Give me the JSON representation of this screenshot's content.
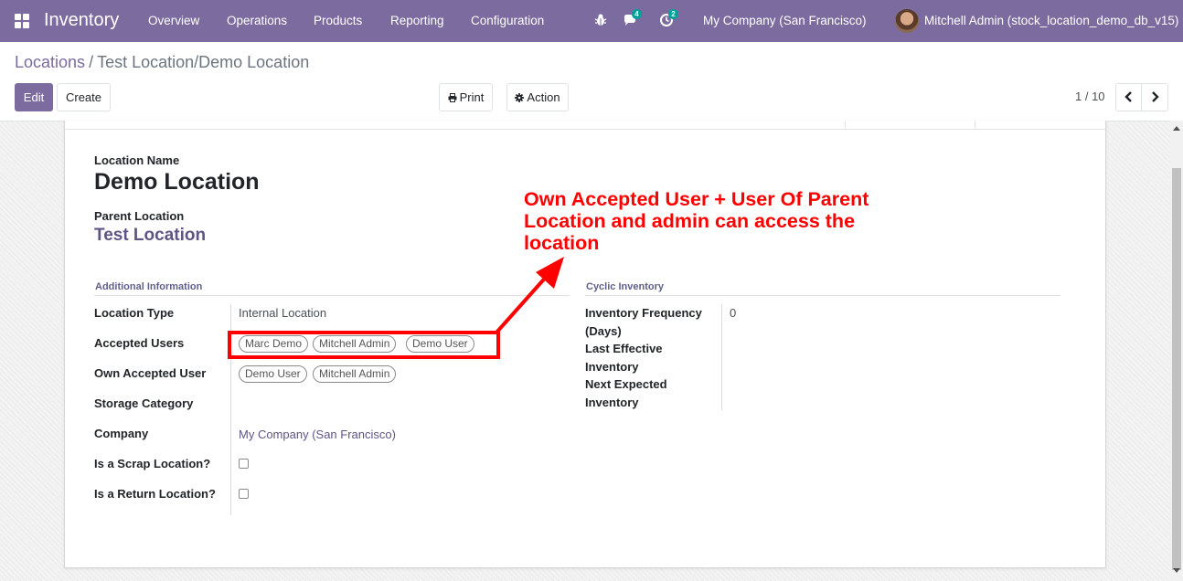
{
  "navbar": {
    "app_name": "Inventory",
    "menu": [
      "Overview",
      "Operations",
      "Products",
      "Reporting",
      "Configuration"
    ],
    "messages_count": "4",
    "activities_count": "2",
    "company": "My Company (San Francisco)",
    "user": "Mitchell Admin (stock_location_demo_db_v15)",
    "icons": [
      "apps-grid-icon",
      "bug-icon",
      "chat-icon",
      "clock-icon"
    ]
  },
  "breadcrumb": {
    "parent": "Locations",
    "separator": "/",
    "current": "Test Location/Demo Location"
  },
  "toolbar": {
    "edit": "Edit",
    "create": "Create",
    "print": "Print",
    "action": "Action",
    "pager": "1 / 10"
  },
  "form": {
    "name_label": "Location Name",
    "name_value": "Demo Location",
    "parent_label": "Parent Location",
    "parent_value": "Test Location",
    "group_additional": "Additional Information",
    "group_cyclic": "Cyclic Inventory",
    "fields": {
      "location_type": {
        "label": "Location Type",
        "value": "Internal Location"
      },
      "accepted_users": {
        "label": "Accepted Users",
        "tags": [
          "Marc Demo",
          "Mitchell Admin",
          "Demo User"
        ]
      },
      "own_accepted_user": {
        "label": "Own Accepted User",
        "tags": [
          "Demo User",
          "Mitchell Admin"
        ]
      },
      "storage_category": {
        "label": "Storage Category",
        "value": ""
      },
      "company": {
        "label": "Company",
        "value": "My Company (San Francisco)"
      },
      "scrap": {
        "label": "Is a Scrap Location?",
        "checked": false
      },
      "return": {
        "label": "Is a Return Location?",
        "checked": false
      }
    },
    "cyclic": {
      "frequency_label_1": "Inventory Frequency",
      "frequency_label_2": "(Days)",
      "frequency_value": "0",
      "last_label_1": "Last Effective",
      "last_label_2": "Inventory",
      "next_label_1": "Next Expected",
      "next_label_2": "Inventory"
    }
  },
  "annotation": {
    "line1": "Own Accepted User + User Of Parent",
    "line2": "Location and admin can access the",
    "line3": "location",
    "color": "#ff0000"
  },
  "colors": {
    "brand": "#7c6b9e",
    "link": "#5f5584",
    "badge": "#00a09d"
  }
}
